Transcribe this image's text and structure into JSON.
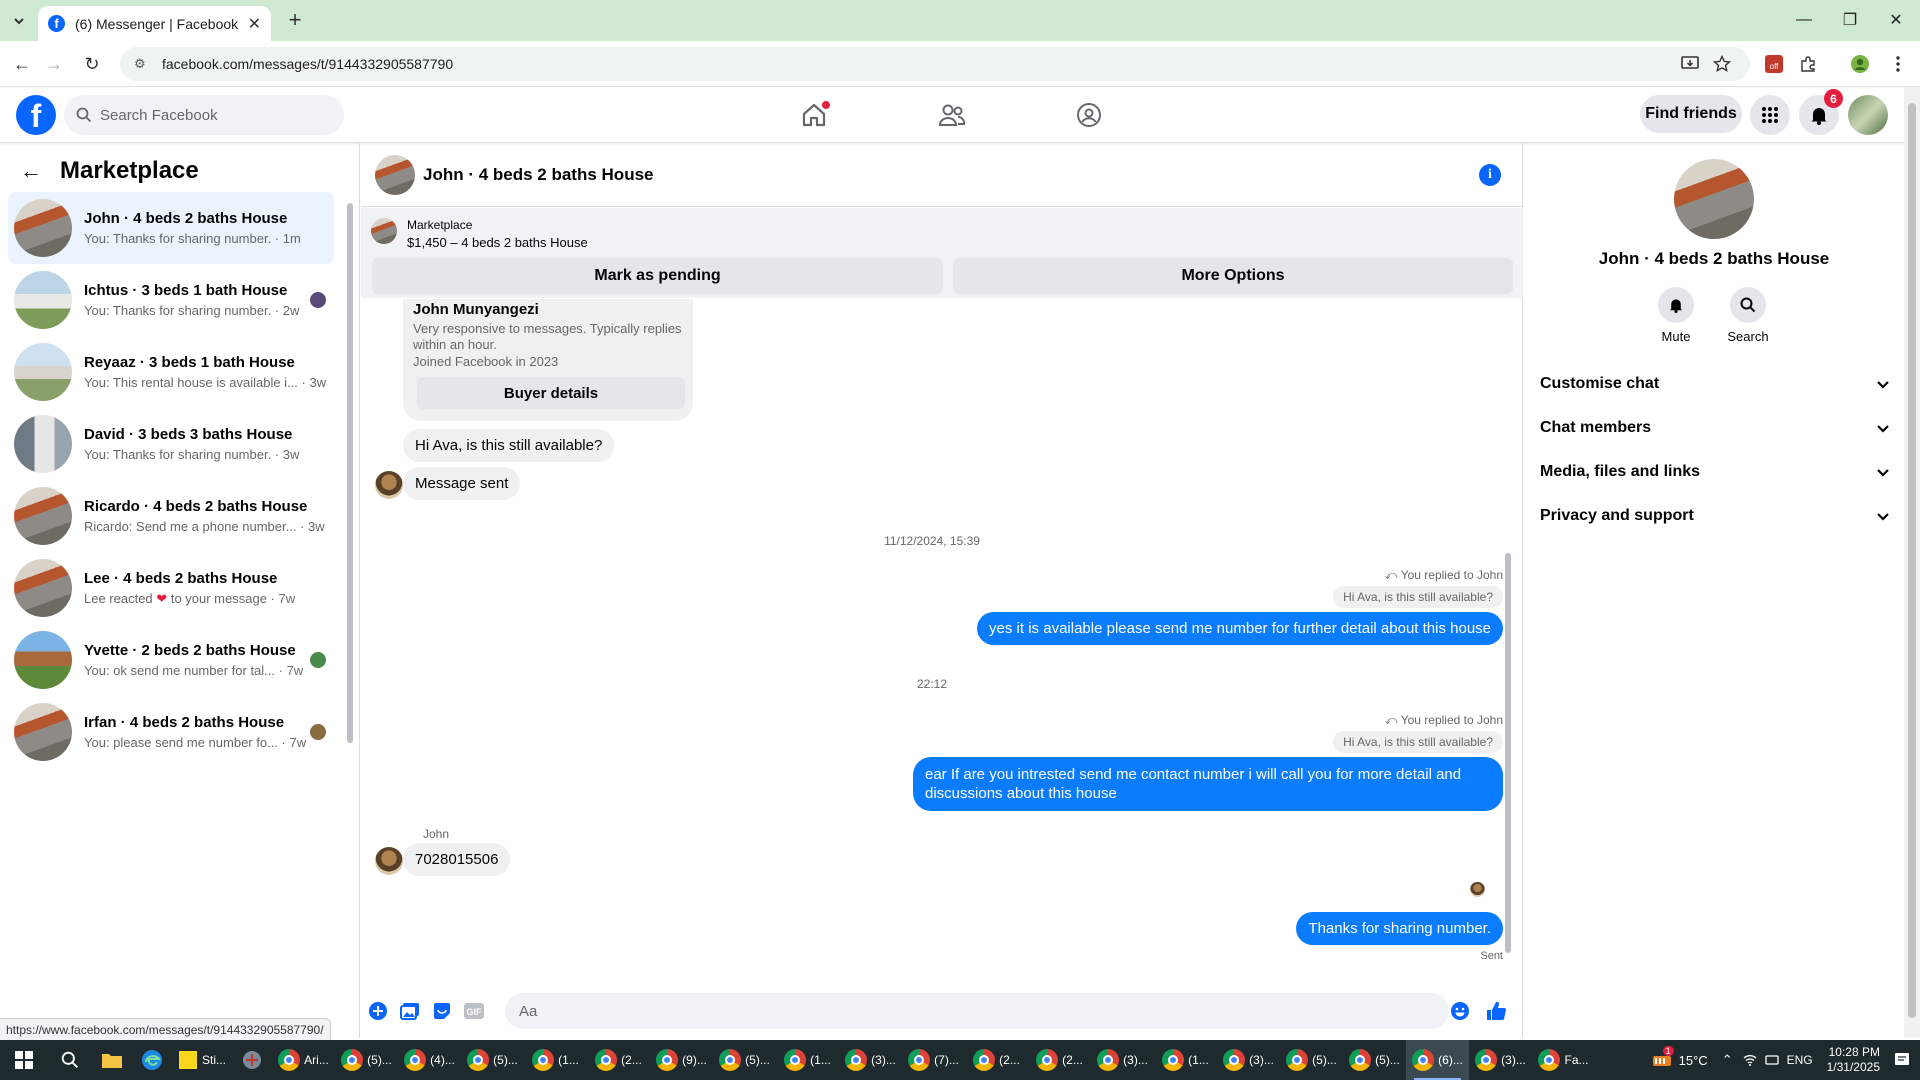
{
  "browser": {
    "tab_title": "(6) Messenger | Facebook",
    "url": "facebook.com/messages/t/9144332905587790",
    "status_url": "https://www.facebook.com/messages/t/9144332905587790/"
  },
  "fb_header": {
    "search_placeholder": "Search Facebook",
    "find_friends": "Find friends",
    "notification_count": "6"
  },
  "left": {
    "title": "Marketplace",
    "conversations": [
      {
        "name": "John · 4 beds 2 baths House",
        "preview": "You: Thanks for sharing number. · 1m"
      },
      {
        "name": "Ichtus · 3 beds 1 bath House",
        "preview": "You: Thanks for sharing number. · 2w"
      },
      {
        "name": "Reyaaz · 3 beds 1 bath House",
        "preview": "You: This rental house is available i... · 3w"
      },
      {
        "name": "David · 3 beds 3 baths House",
        "preview": "You: Thanks for sharing number. · 3w"
      },
      {
        "name": "Ricardo · 4 beds 2 baths House",
        "preview": "Ricardo: Send me a phone number... · 3w"
      },
      {
        "name": "Lee · 4 beds 2 baths House",
        "preview_before": "Lee reacted",
        "preview_after": "to your message · 7w"
      },
      {
        "name": "Yvette · 2 beds 2 baths House",
        "preview": "You: ok send me number for tal... · 7w"
      },
      {
        "name": "Irfan · 4 beds 2 baths House",
        "preview": "You: please send me number fo... · 7w"
      }
    ]
  },
  "chat": {
    "title": "John · 4 beds 2 baths House",
    "listing_category": "Marketplace",
    "listing_price": "$1,450 – 4 beds 2 baths House",
    "mark_pending": "Mark as pending",
    "more_options": "More Options",
    "buyer": {
      "name": "John Munyangezi",
      "desc": "Very responsive to messages. Typically replies within an hour.",
      "joined": "Joined Facebook in 2023",
      "button": "Buyer details"
    },
    "msg_in_1": "Hi Ava, is this still available?",
    "msg_in_2": "Message sent",
    "ts_1": "11/12/2024, 15:39",
    "replied_to_1": "You replied to John",
    "reply_ref_1": "Hi Ava, is this still available?",
    "msg_out_1": "yes it is available please send me number for further detail about this house",
    "ts_2": "22:12",
    "replied_to_2": "You replied to John",
    "reply_ref_2": "Hi Ava, is this still available?",
    "msg_out_2": "ear    If are you intrested  send me contact number  i will call you for more detail and discussions about this house",
    "sender_label": "John",
    "msg_in_3": "7028015506",
    "msg_out_3": "Thanks for sharing number.",
    "sent_status": "Sent",
    "composer_placeholder": "Aa"
  },
  "right": {
    "title": "John · 4 beds 2 baths House",
    "mute": "Mute",
    "search": "Search",
    "sections": [
      "Customise chat",
      "Chat members",
      "Media, files and links",
      "Privacy and support"
    ]
  },
  "taskbar": {
    "items": [
      "Ari...",
      "(5)...",
      "(4)...",
      "(5)...",
      "(1...",
      "(2...",
      "(9)...",
      "(5)...",
      "(1...",
      "(3)...",
      "(7)...",
      "(2...",
      "(2...",
      "(3)...",
      "(1...",
      "(3)...",
      "(5)...",
      "(5)...",
      "(6)...",
      "(3)...",
      "Fa..."
    ],
    "active_index": 18,
    "search_label": "Sti...",
    "weather": "15°C",
    "lang": "ENG",
    "time": "10:28 PM",
    "date": "1/31/2025",
    "notif_count": "1"
  },
  "colors": {
    "fb_blue": "#0866ff",
    "messenger_blue": "#0a7cff",
    "tab_green": "#cfe9d2"
  }
}
